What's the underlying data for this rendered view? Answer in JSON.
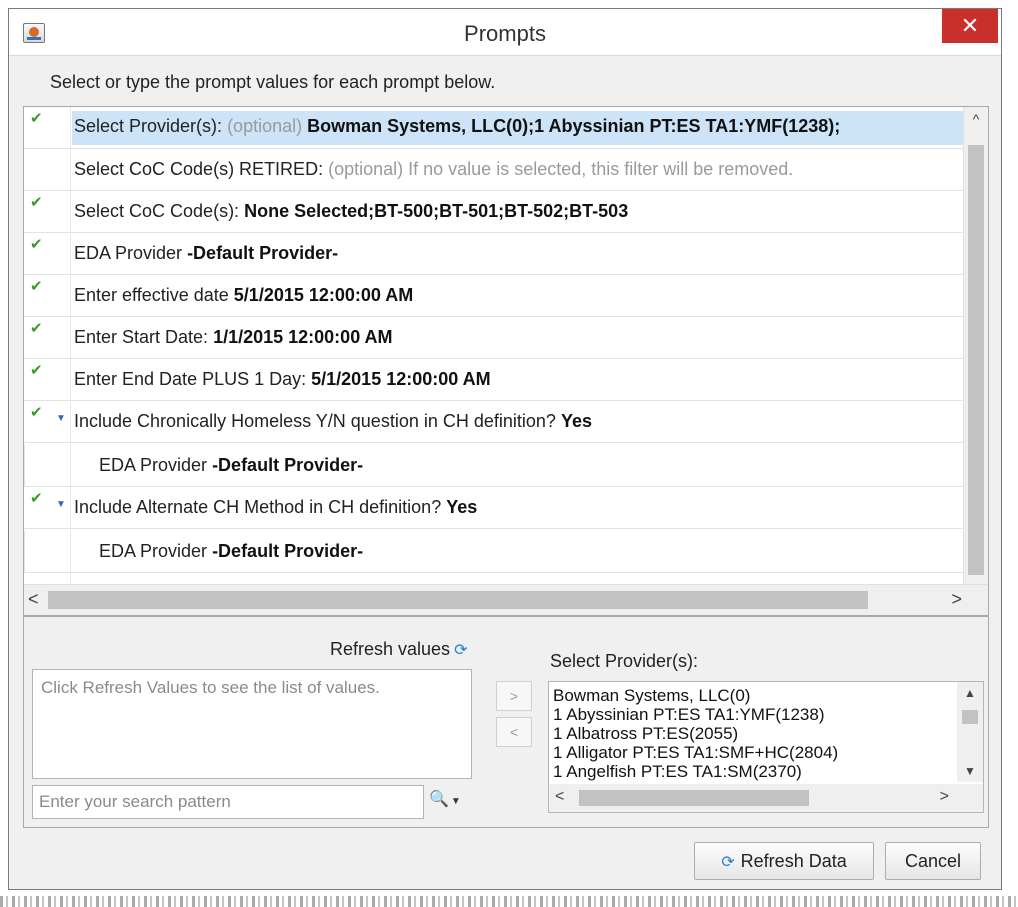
{
  "window": {
    "title": "Prompts",
    "close_label": "✕"
  },
  "instruction": "Select or type the prompt values for each prompt below.",
  "prompts": [
    {
      "label": "Select Provider(s):",
      "optional": "(optional)",
      "value": "Bowman Systems, LLC(0);1 Abyssinian PT:ES TA1:YMF(1238);",
      "checked": true,
      "selected": true
    },
    {
      "label": "Select CoC Code(s) RETIRED:",
      "optional": "(optional) If no value is selected, this filter will be removed.",
      "value": "",
      "checked": false
    },
    {
      "label": "Select CoC Code(s):",
      "optional": "",
      "value": "None Selected;BT-500;BT-501;BT-502;BT-503",
      "checked": true
    },
    {
      "label": "EDA Provider",
      "optional": "",
      "value": "-Default Provider-",
      "checked": true
    },
    {
      "label": "Enter effective date",
      "optional": "",
      "value": "5/1/2015 12:00:00 AM",
      "checked": true
    },
    {
      "label": "Enter Start Date:",
      "optional": "",
      "value": "1/1/2015 12:00:00 AM",
      "checked": true
    },
    {
      "label": "Enter End Date PLUS 1 Day:",
      "optional": "",
      "value": "5/1/2015 12:00:00 AM",
      "checked": true
    },
    {
      "label": "Include Chronically Homeless Y/N question in CH definition?",
      "optional": "",
      "value": "Yes",
      "checked": true,
      "expandable": true
    },
    {
      "label": "EDA Provider",
      "optional": "",
      "value": "-Default Provider-",
      "child": true
    },
    {
      "label": "Include Alternate CH Method in CH definition?",
      "optional": "",
      "value": "Yes",
      "checked": true,
      "expandable": true
    },
    {
      "label": "EDA Provider",
      "optional": "",
      "value": "-Default Provider-",
      "child": true
    }
  ],
  "values_panel": {
    "refresh_label": "Refresh values",
    "empty_message": "Click Refresh Values to see the list of values.",
    "search_placeholder": "Enter your search pattern",
    "add_label": ">",
    "remove_label": "<",
    "selected_heading": "Select Provider(s):",
    "selected_items": [
      "Bowman Systems, LLC(0)",
      "1 Abyssinian  PT:ES   TA1:YMF(1238)",
      "1 Albatross  PT:ES(2055)",
      "1 Alligator  PT:ES   TA1:SMF+HC(2804)",
      "1 Angelfish  PT:ES   TA1:SM(2370)"
    ]
  },
  "buttons": {
    "refresh_data": "Refresh Data",
    "cancel": "Cancel"
  },
  "icons": {
    "check": "check-icon",
    "refresh": "refresh-icon",
    "binoculars": "binoculars-icon",
    "close": "close-icon"
  },
  "colors": {
    "selection": "#cde3f7",
    "check": "#3a9a2a",
    "close": "#c9302c",
    "accent": "#2a7fd0"
  }
}
